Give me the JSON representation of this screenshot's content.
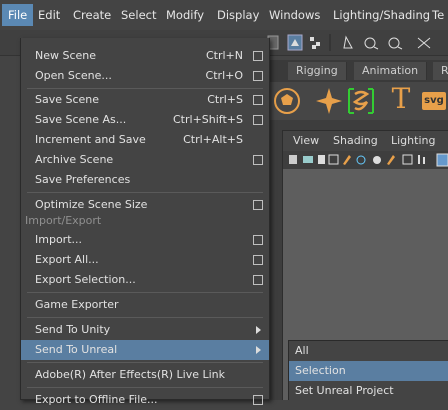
{
  "menubar": {
    "items": [
      "File",
      "Edit",
      "Create",
      "Select",
      "Modify",
      "Display",
      "Windows",
      "Lighting/Shading",
      "Te"
    ]
  },
  "shelf": {
    "tabs": [
      "Rigging",
      "Animation",
      "R"
    ],
    "text_icon": "T",
    "svg_icon_label": "svg"
  },
  "viewport": {
    "menu": [
      "View",
      "Shading",
      "Lighting"
    ]
  },
  "file_menu": {
    "items": [
      {
        "label": "New Scene",
        "shortcut": "Ctrl+N",
        "option": true
      },
      {
        "label": "Open Scene...",
        "shortcut": "Ctrl+O",
        "option": true
      },
      {
        "label": "Save Scene",
        "shortcut": "Ctrl+S",
        "option": true
      },
      {
        "label": "Save Scene As...",
        "shortcut": "Ctrl+Shift+S",
        "option": true
      },
      {
        "label": "Increment and Save",
        "shortcut": "Ctrl+Alt+S",
        "option": false
      },
      {
        "label": "Archive Scene",
        "shortcut": "",
        "option": true
      },
      {
        "label": "Save Preferences",
        "shortcut": "",
        "option": false
      },
      {
        "label": "Optimize Scene Size",
        "shortcut": "",
        "option": true
      },
      {
        "label": "Import...",
        "shortcut": "",
        "option": true
      },
      {
        "label": "Export All...",
        "shortcut": "",
        "option": true
      },
      {
        "label": "Export Selection...",
        "shortcut": "",
        "option": true
      },
      {
        "label": "Game Exporter",
        "shortcut": "",
        "option": false
      },
      {
        "label": "Send To Unity",
        "shortcut": "",
        "option": false
      },
      {
        "label": "Send To Unreal",
        "shortcut": "",
        "option": false
      },
      {
        "label": "Adobe(R) After Effects(R) Live Link",
        "shortcut": "",
        "option": false
      },
      {
        "label": "Export to Offline File...",
        "shortcut": "",
        "option": true
      }
    ],
    "section_import_export": "Import/Export"
  },
  "send_to_unreal_submenu": {
    "items": [
      "All",
      "Selection",
      "Set Unreal Project"
    ]
  },
  "colors": {
    "menu_bg": "#444444",
    "highlight": "#5a7ea1",
    "menubar_active": "#5b89b4",
    "icon_orange": "#e8a04a"
  }
}
